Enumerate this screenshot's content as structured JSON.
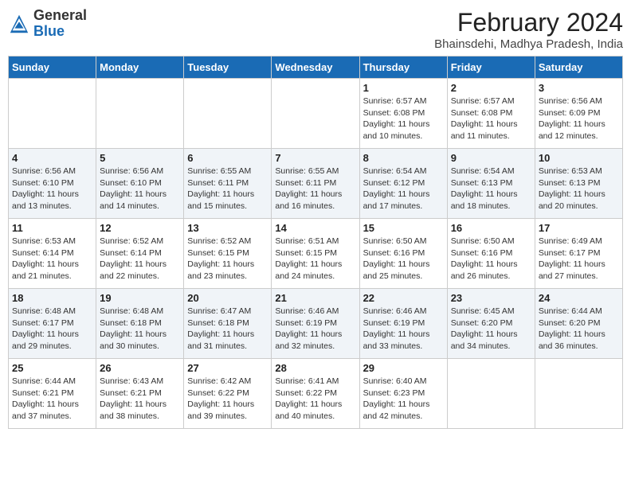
{
  "header": {
    "logo_general": "General",
    "logo_blue": "Blue",
    "month_year": "February 2024",
    "location": "Bhainsdehi, Madhya Pradesh, India"
  },
  "days_of_week": [
    "Sunday",
    "Monday",
    "Tuesday",
    "Wednesday",
    "Thursday",
    "Friday",
    "Saturday"
  ],
  "weeks": [
    [
      {
        "day": "",
        "info": ""
      },
      {
        "day": "",
        "info": ""
      },
      {
        "day": "",
        "info": ""
      },
      {
        "day": "",
        "info": ""
      },
      {
        "day": "1",
        "info": "Sunrise: 6:57 AM\nSunset: 6:08 PM\nDaylight: 11 hours\nand 10 minutes."
      },
      {
        "day": "2",
        "info": "Sunrise: 6:57 AM\nSunset: 6:08 PM\nDaylight: 11 hours\nand 11 minutes."
      },
      {
        "day": "3",
        "info": "Sunrise: 6:56 AM\nSunset: 6:09 PM\nDaylight: 11 hours\nand 12 minutes."
      }
    ],
    [
      {
        "day": "4",
        "info": "Sunrise: 6:56 AM\nSunset: 6:10 PM\nDaylight: 11 hours\nand 13 minutes."
      },
      {
        "day": "5",
        "info": "Sunrise: 6:56 AM\nSunset: 6:10 PM\nDaylight: 11 hours\nand 14 minutes."
      },
      {
        "day": "6",
        "info": "Sunrise: 6:55 AM\nSunset: 6:11 PM\nDaylight: 11 hours\nand 15 minutes."
      },
      {
        "day": "7",
        "info": "Sunrise: 6:55 AM\nSunset: 6:11 PM\nDaylight: 11 hours\nand 16 minutes."
      },
      {
        "day": "8",
        "info": "Sunrise: 6:54 AM\nSunset: 6:12 PM\nDaylight: 11 hours\nand 17 minutes."
      },
      {
        "day": "9",
        "info": "Sunrise: 6:54 AM\nSunset: 6:13 PM\nDaylight: 11 hours\nand 18 minutes."
      },
      {
        "day": "10",
        "info": "Sunrise: 6:53 AM\nSunset: 6:13 PM\nDaylight: 11 hours\nand 20 minutes."
      }
    ],
    [
      {
        "day": "11",
        "info": "Sunrise: 6:53 AM\nSunset: 6:14 PM\nDaylight: 11 hours\nand 21 minutes."
      },
      {
        "day": "12",
        "info": "Sunrise: 6:52 AM\nSunset: 6:14 PM\nDaylight: 11 hours\nand 22 minutes."
      },
      {
        "day": "13",
        "info": "Sunrise: 6:52 AM\nSunset: 6:15 PM\nDaylight: 11 hours\nand 23 minutes."
      },
      {
        "day": "14",
        "info": "Sunrise: 6:51 AM\nSunset: 6:15 PM\nDaylight: 11 hours\nand 24 minutes."
      },
      {
        "day": "15",
        "info": "Sunrise: 6:50 AM\nSunset: 6:16 PM\nDaylight: 11 hours\nand 25 minutes."
      },
      {
        "day": "16",
        "info": "Sunrise: 6:50 AM\nSunset: 6:16 PM\nDaylight: 11 hours\nand 26 minutes."
      },
      {
        "day": "17",
        "info": "Sunrise: 6:49 AM\nSunset: 6:17 PM\nDaylight: 11 hours\nand 27 minutes."
      }
    ],
    [
      {
        "day": "18",
        "info": "Sunrise: 6:48 AM\nSunset: 6:17 PM\nDaylight: 11 hours\nand 29 minutes."
      },
      {
        "day": "19",
        "info": "Sunrise: 6:48 AM\nSunset: 6:18 PM\nDaylight: 11 hours\nand 30 minutes."
      },
      {
        "day": "20",
        "info": "Sunrise: 6:47 AM\nSunset: 6:18 PM\nDaylight: 11 hours\nand 31 minutes."
      },
      {
        "day": "21",
        "info": "Sunrise: 6:46 AM\nSunset: 6:19 PM\nDaylight: 11 hours\nand 32 minutes."
      },
      {
        "day": "22",
        "info": "Sunrise: 6:46 AM\nSunset: 6:19 PM\nDaylight: 11 hours\nand 33 minutes."
      },
      {
        "day": "23",
        "info": "Sunrise: 6:45 AM\nSunset: 6:20 PM\nDaylight: 11 hours\nand 34 minutes."
      },
      {
        "day": "24",
        "info": "Sunrise: 6:44 AM\nSunset: 6:20 PM\nDaylight: 11 hours\nand 36 minutes."
      }
    ],
    [
      {
        "day": "25",
        "info": "Sunrise: 6:44 AM\nSunset: 6:21 PM\nDaylight: 11 hours\nand 37 minutes."
      },
      {
        "day": "26",
        "info": "Sunrise: 6:43 AM\nSunset: 6:21 PM\nDaylight: 11 hours\nand 38 minutes."
      },
      {
        "day": "27",
        "info": "Sunrise: 6:42 AM\nSunset: 6:22 PM\nDaylight: 11 hours\nand 39 minutes."
      },
      {
        "day": "28",
        "info": "Sunrise: 6:41 AM\nSunset: 6:22 PM\nDaylight: 11 hours\nand 40 minutes."
      },
      {
        "day": "29",
        "info": "Sunrise: 6:40 AM\nSunset: 6:23 PM\nDaylight: 11 hours\nand 42 minutes."
      },
      {
        "day": "",
        "info": ""
      },
      {
        "day": "",
        "info": ""
      }
    ]
  ]
}
